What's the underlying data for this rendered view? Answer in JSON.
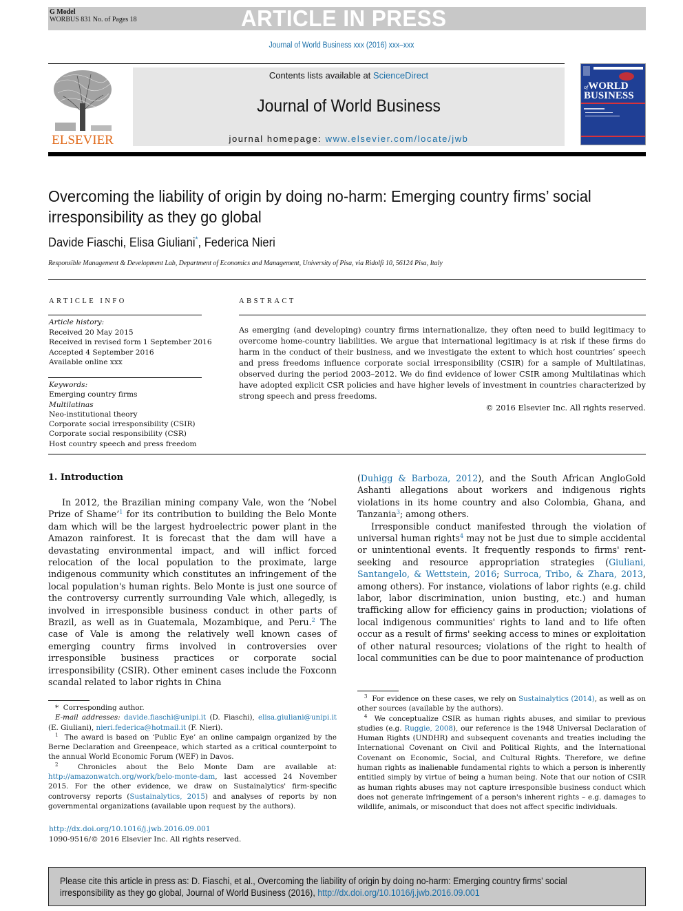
{
  "header": {
    "g_model": "G Model",
    "manuscript": "WORBUS 831 No. of Pages 18",
    "banner": "ARTICLE IN PRESS",
    "journal_ref": "Journal of World Business xxx (2016) xxx–xxx"
  },
  "masthead": {
    "publisher": "ELSEVIER",
    "contents_prefix": "Contents lists available at ",
    "contents_link": "ScienceDirect",
    "journal_title": "Journal of World Business",
    "homepage_prefix": "journal homepage: ",
    "homepage_link": "www.elsevier.com/locate/jwb",
    "cover_text_top": "WORLD",
    "cover_text_bottom": "BUSINESS",
    "cover_prefix": "of"
  },
  "article": {
    "title": "Overcoming the liability of origin by doing no-harm: Emerging country firms’ social irresponsibility as they go global",
    "authors": [
      {
        "name": "Davide Fiaschi",
        "mark": ""
      },
      {
        "name": "Elisa Giuliani",
        "mark": "*"
      },
      {
        "name": "Federica Nieri",
        "mark": ""
      }
    ],
    "affiliation": "Responsible Management & Development Lab, Department of Economics and Management, University of Pisa, via Ridolfi 10, 56124 Pisa, Italy"
  },
  "article_info": {
    "heading": "ARTICLE INFO",
    "history_label": "Article history:",
    "history": [
      "Received 20 May 2015",
      "Received in revised form 1 September 2016",
      "Accepted 4 September 2016",
      "Available online xxx"
    ],
    "keywords_label": "Keywords:",
    "keywords": [
      "Emerging country firms",
      "Multilatinas",
      "Neo-institutional theory",
      "Corporate social irresponsibility (CSIR)",
      "Corporate social responsibility (CSR)",
      "Host country speech and press freedom"
    ]
  },
  "abstract": {
    "heading": "ABSTRACT",
    "text": "As emerging (and developing) country firms internationalize, they often need to build legitimacy to overcome home-country liabilities. We argue that international legitimacy is at risk if these firms do harm in the conduct of their business, and we investigate the extent to which host countries’ speech and press freedoms influence corporate social irresponsibility (CSIR) for a sample of Multilatinas, observed during the period 2003–2012. We do find evidence of lower CSIR among Multilatinas which have adopted explicit CSR policies and have higher levels of investment in countries characterized by strong speech and press freedoms.",
    "copyright": "© 2016 Elsevier Inc. All rights reserved."
  },
  "body": {
    "section_heading": "1. Introduction",
    "col1": {
      "p1_a": "In 2012, the Brazilian mining company Vale, won the ‘Nobel Prize of Shame’",
      "fn1": "1",
      "p1_b": " for its contribution to building the Belo Monte dam which will be the largest hydroelectric power plant in the Amazon rainforest. It is forecast that the dam will have a devastating environmental impact, and will inflict forced relocation of the local population to the proximate, large indigenous community which constitutes an infringement of the local population's human rights. Belo Monte is just one source of the controversy currently surrounding Vale which, allegedly, is involved in irresponsible business conduct in other parts of Brazil, as well as in Guatemala, Mozambique, and Peru.",
      "fn2": "2",
      "p1_c": " The case of Vale is among the relatively well known cases of emerging country firms involved in controversies over irresponsible business practices or corporate social irresponsibility (CSIR). Other eminent cases include the Foxconn scandal related to labor rights in China"
    },
    "col2": {
      "p1_open": "(",
      "cite1": "Duhigg & Barboza, 2012",
      "p1_a": "), and the South African AngloGold Ashanti allegations about workers and indigenous rights violations in its home country and also Colombia, Ghana, and Tanzania",
      "fn3": "3",
      "p1_b": "; among others.",
      "p2_a": "Irresponsible conduct manifested through the violation of universal human rights",
      "fn4": "4",
      "p2_b": " may not be just due to simple accidental or unintentional events. It frequently responds to firms' rent-seeking and resource appropriation strategies (",
      "cite2": "Giuliani, Santangelo, & Wettstein, 2016",
      "sep": "; ",
      "cite3": "Surroca, Tribo, & Zhara, 2013",
      "p2_c": ", among others). For instance, violations of labor rights (e.g. child labor, labor discrimination, union busting, etc.) and human trafficking allow for efficiency gains in production; violations of local indigenous communities' rights to land and to life often occur as a result of firms' seeking access to mines or exploitation of other natural resources; violations of the right to health of local communities can be due to poor maintenance of production"
    }
  },
  "footnotes_left": {
    "corresponding_mark": "*",
    "corresponding": "Corresponding author.",
    "email_label": "E-mail addresses: ",
    "emails": [
      {
        "address": "davide.fiaschi@unipi.it",
        "who": " (D. Fiaschi), "
      },
      {
        "address": "elisa.giuliani@unipi.it",
        "who": " (E. Giuliani), "
      },
      {
        "address": "nieri.federica@hotmail.it",
        "who": " (F. Nieri)."
      }
    ],
    "fn1_mark": "1",
    "fn1": "The award is based on ‘Public Eye’ an online campaign organized by the Berne Declaration and Greenpeace, which started as a critical counterpoint to the annual World Economic Forum (WEF) in Davos.",
    "fn2_mark": "2",
    "fn2_a": "Chronicles about the Belo Monte Dam are available at: ",
    "fn2_link": "http://amazonwatch.org/work/belo-monte-dam",
    "fn2_b": ", last accessed 24 November 2015. For the other evidence, we draw on Sustainalytics' firm-specific controversy reports (",
    "fn2_cite": "Sustainalytics, 2015",
    "fn2_c": ") and analyses of reports by non governmental organizations (available upon request by the authors)."
  },
  "footnotes_right": {
    "fn3_mark": "3",
    "fn3_a": "For evidence on these cases, we rely on ",
    "fn3_cite": "Sustainalytics (2014)",
    "fn3_b": ", as well as on other sources (available by the authors).",
    "fn4_mark": "4",
    "fn4_a": "We conceptualize CSIR as human rights abuses, and similar to previous studies (e.g. ",
    "fn4_cite": "Ruggie, 2008",
    "fn4_b": "), our reference is the 1948 Universal Declaration of Human Rights (UNDHR) and subsequent covenants and treaties including the International Covenant on Civil and Political Rights, and the International Covenant on Economic, Social, and Cultural Rights. Therefore, we define human rights as inalienable fundamental rights to which a person is inherently entitled simply by virtue of being a human being. Note that our notion of CSIR as human rights abuses may not capture irresponsible business conduct which does not generate infringement of a person's inherent rights – e.g. damages to wildlife, animals, or misconduct that does not affect specific individuals."
  },
  "doi": {
    "link": "http://dx.doi.org/10.1016/j.jwb.2016.09.001",
    "issn": "1090-9516/© 2016 Elsevier Inc. All rights reserved."
  },
  "cite_box": {
    "text": "Please cite this article in press as: D. Fiaschi, et al., Overcoming the liability of origin by doing no-harm: Emerging country firms’ social irresponsibility as they go global, Journal of World Business (2016), ",
    "link": "http://dx.doi.org/10.1016/j.jwb.2016.09.001"
  },
  "colors": {
    "link": "#1a6fa8",
    "elsevier_orange": "#e06a1b",
    "cover_blue": "#1f3f95",
    "banner_gray": "#c8c8c8"
  }
}
